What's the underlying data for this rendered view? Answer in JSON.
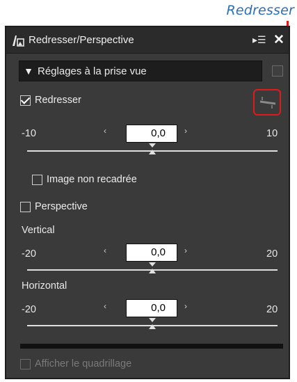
{
  "callout": {
    "label": "Redresser"
  },
  "panel": {
    "title": "Redresser/Perspective",
    "menu_icon": "menu-list-icon",
    "close_icon": "close-icon"
  },
  "preset": {
    "selected": "Réglages à la prise vue"
  },
  "straighten": {
    "checkbox_label": "Redresser",
    "checked": true,
    "min": "-10",
    "max": "10",
    "value": "0,0",
    "slider_fraction": 0.5
  },
  "uncropped": {
    "label": "Image non recadrée",
    "checked": false
  },
  "perspective": {
    "checkbox_label": "Perspective",
    "checked": false,
    "vertical": {
      "label": "Vertical",
      "min": "-20",
      "max": "20",
      "value": "0,0",
      "slider_fraction": 0.5
    },
    "horizontal": {
      "label": "Horizontal",
      "min": "-20",
      "max": "20",
      "value": "0,0",
      "slider_fraction": 0.5
    }
  },
  "grid": {
    "label": "Afficher le quadrillage",
    "checked": false,
    "enabled": false
  },
  "colors": {
    "panel_bg": "#3a3a3a",
    "accent_red": "#e11a1a",
    "callout_blue": "#2a6fb8"
  }
}
